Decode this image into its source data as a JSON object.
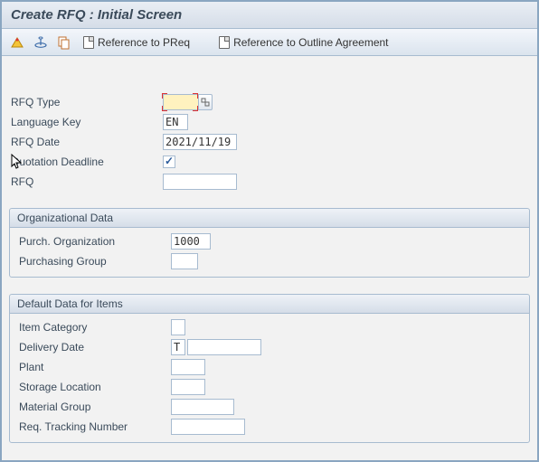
{
  "title": "Create RFQ : Initial Screen",
  "toolbar": {
    "ref_preq": "Reference to PReq",
    "ref_outline": "Reference to Outline Agreement"
  },
  "top": {
    "rfq_type_label": "RFQ Type",
    "rfq_type_value": "",
    "language_key_label": "Language Key",
    "language_key_value": "EN",
    "rfq_date_label": "RFQ Date",
    "rfq_date_value": "2021/11/19",
    "quotation_deadline_label": "Quotation Deadline",
    "quotation_deadline_checked": true,
    "rfq_label": "RFQ",
    "rfq_value": ""
  },
  "org": {
    "group_label": "Organizational Data",
    "purch_org_label": "Purch. Organization",
    "purch_org_value": "1000",
    "purch_group_label": "Purchasing Group",
    "purch_group_value": ""
  },
  "def": {
    "group_label": "Default Data for Items",
    "item_cat_label": "Item Category",
    "item_cat_value": "",
    "deliv_date_label": "Delivery Date",
    "deliv_date_type": "T",
    "deliv_date_value": "",
    "plant_label": "Plant",
    "plant_value": "",
    "storage_loc_label": "Storage Location",
    "storage_loc_value": "",
    "mat_group_label": "Material Group",
    "mat_group_value": "",
    "req_track_label": "Req. Tracking Number",
    "req_track_value": ""
  }
}
